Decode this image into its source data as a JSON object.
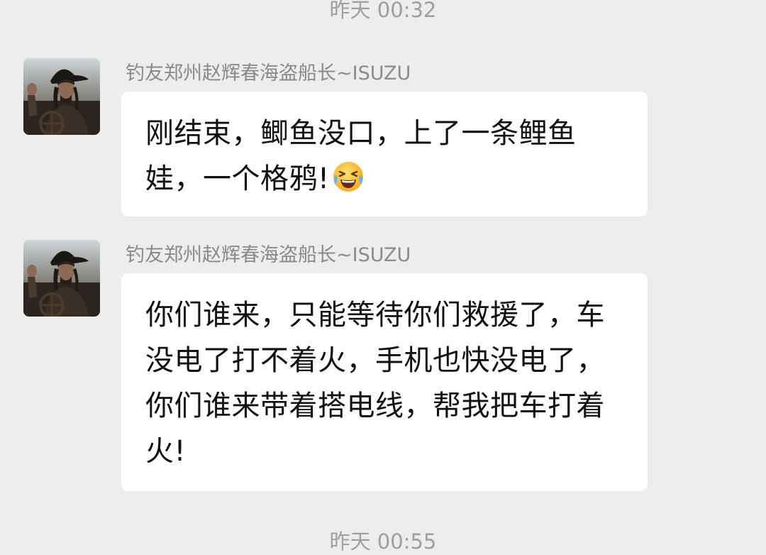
{
  "chat": {
    "timestamps": [
      "昨天 00:32",
      "昨天 00:55"
    ],
    "messages": [
      {
        "sender": "钓友郑州赵辉春海盗船长~ISUZU",
        "avatar_icon": "pirate-captain-avatar",
        "text": "刚结束，鲫鱼没口，上了一条鲤鱼娃，一个格鸦!",
        "emoji": "crying-laughing-face-emoji"
      },
      {
        "sender": "钓友郑州赵辉春海盗船长~ISUZU",
        "avatar_icon": "pirate-captain-avatar",
        "text": "你们谁来，只能等待你们救援了，车没电了打不着火，手机也快没电了，你们谁来带着搭电线，帮我把车打着火!"
      }
    ]
  },
  "colors": {
    "background": "#ededed",
    "bubble": "#ffffff",
    "timestamp": "#9e9e9e",
    "sender": "#8a8a8a",
    "text": "#111111"
  }
}
